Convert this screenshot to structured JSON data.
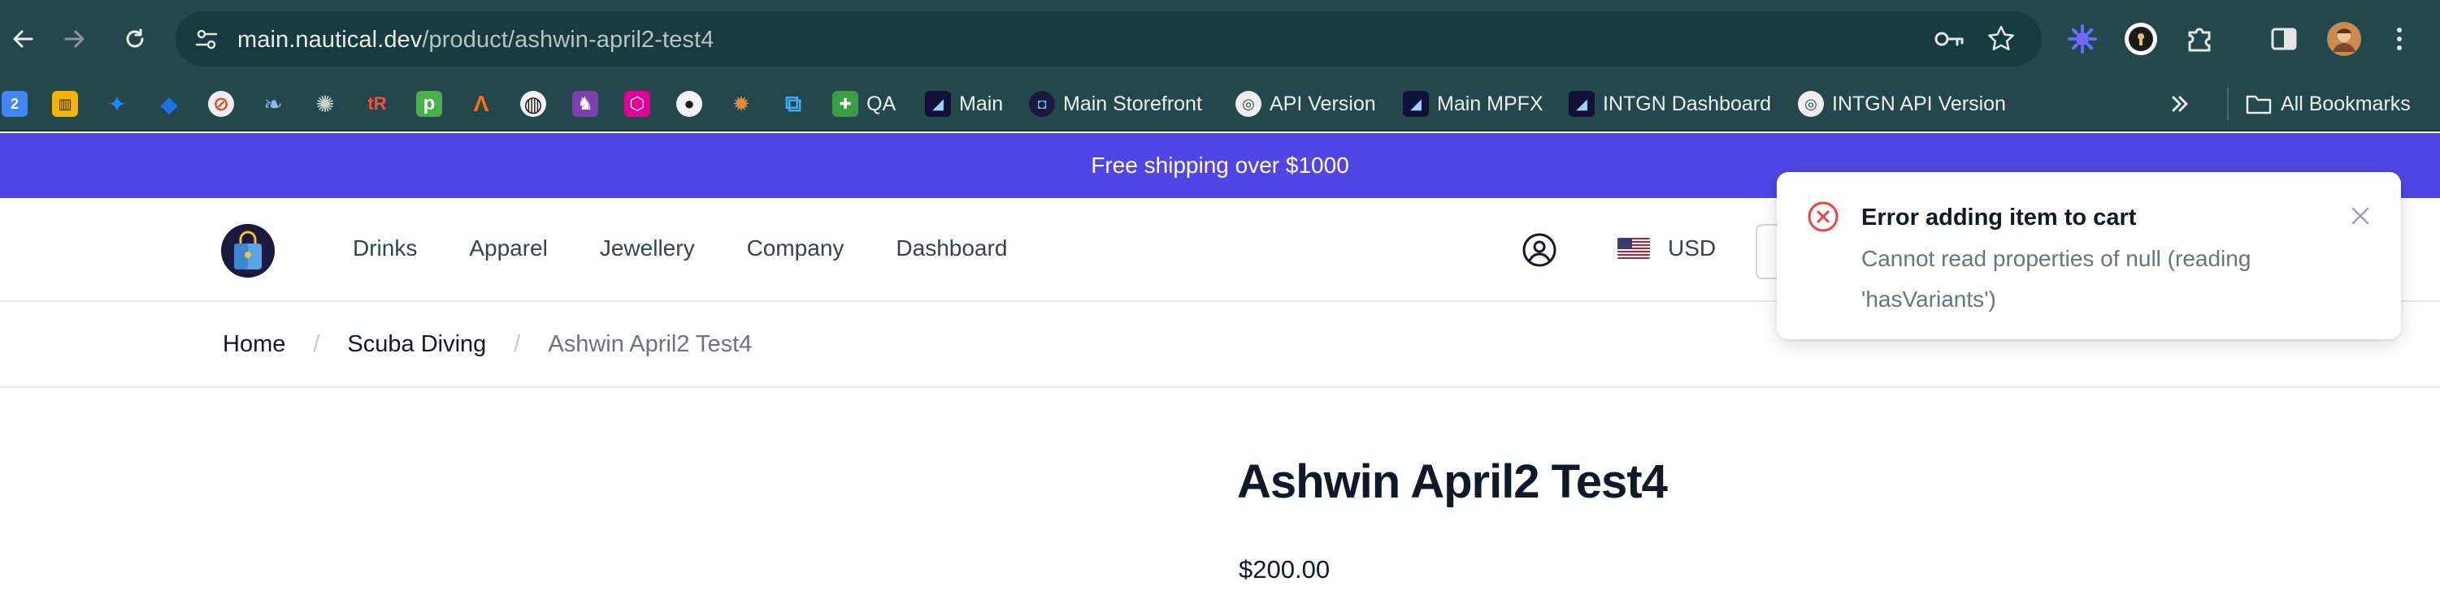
{
  "browser": {
    "url_host": "main.nautical.dev",
    "url_path": "/product/ashwin-april2-test4",
    "bookmarks": [
      {
        "icon": "calendar-icon",
        "label": "",
        "color": "#4285f4",
        "glyph": "2"
      },
      {
        "icon": "trello-icon",
        "label": "",
        "color": "#f5b400",
        "glyph": "▥"
      },
      {
        "icon": "jira-icon",
        "label": "",
        "color": "#2684ff",
        "glyph": "✦"
      },
      {
        "icon": "jira-software-icon",
        "label": "",
        "color": "#1f6fe5",
        "glyph": "◆"
      },
      {
        "icon": "no-entry-icon",
        "label": "",
        "color": "#f0f0f0",
        "glyph": "⊘"
      },
      {
        "icon": "feather-icon",
        "label": "",
        "color": "#7aa7d9",
        "glyph": "❧"
      },
      {
        "icon": "openai-icon",
        "label": "",
        "color": "#8da3a3",
        "glyph": "✺"
      },
      {
        "icon": "tr-icon",
        "label": "",
        "color": "#d62e1f",
        "glyph": "tR"
      },
      {
        "icon": "p-icon",
        "label": "",
        "color": "#46b04a",
        "glyph": "p"
      },
      {
        "icon": "arrow-a-icon",
        "label": "",
        "color": "#ff6a13",
        "glyph": "Ʌ"
      },
      {
        "icon": "stripes-icon",
        "label": "",
        "color": "#1b1b1b",
        "glyph": "◍"
      },
      {
        "icon": "unicorn-icon",
        "label": "",
        "color": "#7e3fb0",
        "glyph": "♞"
      },
      {
        "icon": "graphql-icon",
        "label": "",
        "color": "#e10098",
        "glyph": "⬡"
      },
      {
        "icon": "github-icon",
        "label": "",
        "color": "#1a1a1a",
        "glyph": "●"
      },
      {
        "icon": "bug-icon",
        "label": "",
        "color": "#c8702a",
        "glyph": "✹"
      },
      {
        "icon": "puzzle-blocks-icon",
        "label": "",
        "color": "#3fa9f5",
        "glyph": "⧉"
      },
      {
        "icon": "qa-icon",
        "label": "QA",
        "color": "#3b9c46",
        "glyph": "✚"
      },
      {
        "icon": "nautical-icon",
        "label": "Main",
        "color": "#101038",
        "glyph": "◢"
      },
      {
        "icon": "storefront-bag-icon",
        "label": "Main Storefront",
        "color": "#1a1a3e",
        "glyph": "◘"
      },
      {
        "icon": "globe-icon",
        "label": "API Version",
        "color": "#eeeeee",
        "glyph": "◎"
      },
      {
        "icon": "nautical-icon",
        "label": "Main MPFX",
        "color": "#101038",
        "glyph": "◢"
      },
      {
        "icon": "nautical-icon",
        "label": "INTGN Dashboard",
        "color": "#101038",
        "glyph": "◢"
      },
      {
        "icon": "globe-icon",
        "label": "INTGN API Version",
        "color": "#eeeeee",
        "glyph": "◎"
      }
    ],
    "all_bookmarks_label": "All Bookmarks"
  },
  "promo": {
    "text": "Free shipping over $1000"
  },
  "nav": {
    "items": [
      {
        "label": "Drinks"
      },
      {
        "label": "Apparel"
      },
      {
        "label": "Jewellery"
      },
      {
        "label": "Company"
      },
      {
        "label": "Dashboard"
      }
    ],
    "currency": "USD"
  },
  "breadcrumb": {
    "items": [
      {
        "label": "Home"
      },
      {
        "label": "Scuba Diving"
      }
    ],
    "separator": "/",
    "current": "Ashwin April2 Test4"
  },
  "product": {
    "title": "Ashwin April2 Test4",
    "price": "$200.00"
  },
  "toast": {
    "title": "Error adding item to cart",
    "message": "Cannot read properties of null (reading 'hasVariants')"
  },
  "colors": {
    "promo_bg": "#4f46e5",
    "chrome_bg": "#24474b",
    "error_red": "#ef4444"
  }
}
